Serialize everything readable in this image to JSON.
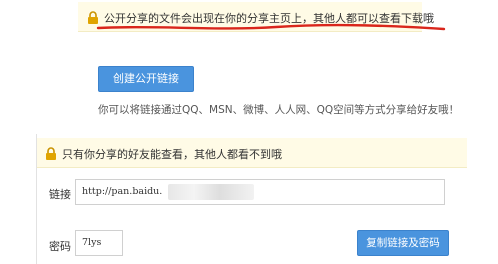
{
  "share_panel": {
    "notice": "公开分享的文件会出现在你的分享主页上，其他人都可以查看下载哦",
    "create_button": "创建公开链接",
    "hint": "你可以将链接通过QQ、MSN、微博、人人网、QQ空间等方式分享给好友哦！"
  },
  "private_panel": {
    "notice": "只有你分享的好友能查看，其他人都看不到哦",
    "link_label": "链接",
    "link_value": "http://pan.baidu.",
    "password_label": "密码",
    "password_value": "7lys",
    "copy_button": "复制链接及密码"
  },
  "colors": {
    "notice_bg": "#fffbe6",
    "lock_icon": "#e0a400",
    "underline": "#d9261c",
    "button": "#4a94de"
  }
}
